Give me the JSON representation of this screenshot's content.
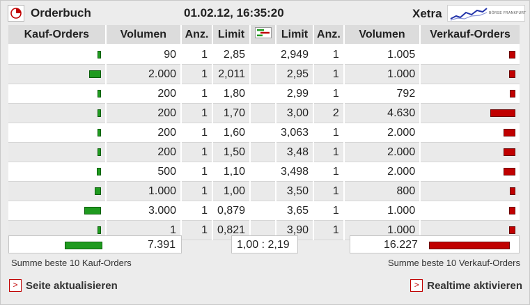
{
  "header": {
    "title": "Orderbuch",
    "datetime": "01.02.12, 16:35:20",
    "exchange": "Xetra",
    "exchange_logo_text": "BÖRSE FRANKFURT"
  },
  "columns": {
    "buy_orders": "Kauf-Orders",
    "buy_volume": "Volumen",
    "buy_count": "Anz.",
    "buy_limit": "Limit",
    "sell_limit": "Limit",
    "sell_count": "Anz.",
    "sell_volume": "Volumen",
    "sell_orders": "Verkauf-Orders"
  },
  "rows": [
    {
      "buy_volume": "90",
      "buy_count": "1",
      "buy_limit": "2,85",
      "sell_limit": "2,949",
      "sell_count": "1",
      "sell_volume": "1.005"
    },
    {
      "buy_volume": "2.000",
      "buy_count": "1",
      "buy_limit": "2,011",
      "sell_limit": "2,95",
      "sell_count": "1",
      "sell_volume": "1.000"
    },
    {
      "buy_volume": "200",
      "buy_count": "1",
      "buy_limit": "1,80",
      "sell_limit": "2,99",
      "sell_count": "1",
      "sell_volume": "792"
    },
    {
      "buy_volume": "200",
      "buy_count": "1",
      "buy_limit": "1,70",
      "sell_limit": "3,00",
      "sell_count": "2",
      "sell_volume": "4.630"
    },
    {
      "buy_volume": "200",
      "buy_count": "1",
      "buy_limit": "1,60",
      "sell_limit": "3,063",
      "sell_count": "1",
      "sell_volume": "2.000"
    },
    {
      "buy_volume": "200",
      "buy_count": "1",
      "buy_limit": "1,50",
      "sell_limit": "3,48",
      "sell_count": "1",
      "sell_volume": "2.000"
    },
    {
      "buy_volume": "500",
      "buy_count": "1",
      "buy_limit": "1,10",
      "sell_limit": "3,498",
      "sell_count": "1",
      "sell_volume": "2.000"
    },
    {
      "buy_volume": "1.000",
      "buy_count": "1",
      "buy_limit": "1,00",
      "sell_limit": "3,50",
      "sell_count": "1",
      "sell_volume": "800"
    },
    {
      "buy_volume": "3.000",
      "buy_count": "1",
      "buy_limit": "0,879",
      "sell_limit": "3,65",
      "sell_count": "1",
      "sell_volume": "1.000"
    },
    {
      "buy_volume": "1",
      "buy_count": "1",
      "buy_limit": "0,821",
      "sell_limit": "3,90",
      "sell_count": "1",
      "sell_volume": "1.000"
    }
  ],
  "summary": {
    "buy_total": "7.391",
    "ratio": "1,00 : 2,19",
    "sell_total": "16.227",
    "buy_caption": "Summe beste 10 Kauf-Orders",
    "sell_caption": "Summe beste 10 Verkauf-Orders"
  },
  "actions": {
    "refresh": "Seite aktualisieren",
    "realtime": "Realtime aktivieren"
  },
  "colors": {
    "buy": "#1f9a1f",
    "sell": "#c00000"
  }
}
